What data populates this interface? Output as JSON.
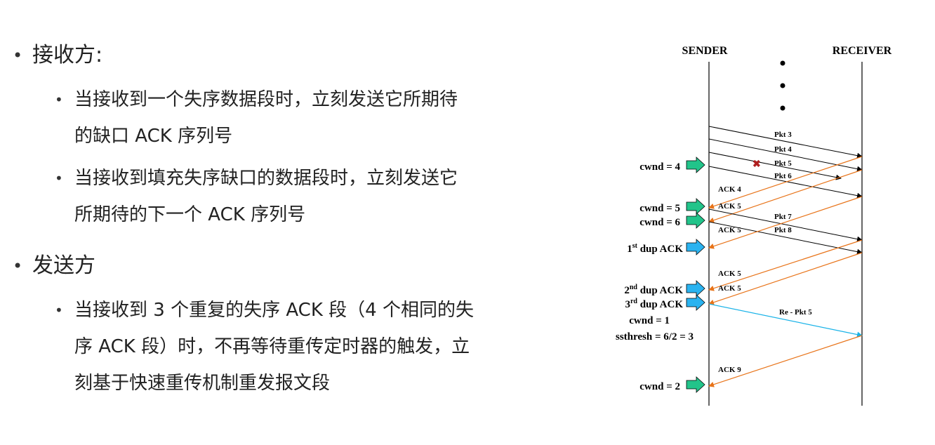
{
  "text": {
    "receiver_heading": "接收方:",
    "receiver_bullets": [
      "当接收到一个失序数据段时，立刻发送它所期待的缺口 ACK 序列号",
      "当接收到填充失序缺口的数据段时，立刻发送它所期待的下一个 ACK 序列号"
    ],
    "sender_heading": "发送方",
    "sender_bullets": [
      "当接收到 3 个重复的失序 ACK 段（4 个相同的失序 ACK 段）时，不再等待重传定时器的触发，立刻基于快速重传机制重发报文段"
    ]
  },
  "diagram": {
    "sender_label": "SENDER",
    "receiver_label": "RECEIVER",
    "left_labels": {
      "cwnd4": "cwnd = 4",
      "cwnd5": "cwnd = 5",
      "cwnd6": "cwnd = 6",
      "dup1_a": "1",
      "dup1_sup": "st",
      "dup1_b": " dup ACK",
      "dup2_a": "2",
      "dup2_sup": "nd",
      "dup2_b": " dup ACK",
      "dup3_a": "3",
      "dup3_sup": "rd",
      "dup3_b": " dup ACK",
      "cwnd1": "cwnd = 1",
      "ssthresh": "ssthresh = 6/2 = 3",
      "cwnd2": "cwnd = 2"
    },
    "msg_labels": {
      "pkt3": "Pkt 3",
      "pkt4": "Pkt 4",
      "pkt5": "Pkt 5",
      "pkt6": "Pkt 6",
      "ack4": "ACK 4",
      "ack5a": "ACK 5",
      "pkt7": "Pkt 7",
      "ack5b": "ACK 5",
      "pkt8": "Pkt 8",
      "ack5c": "ACK 5",
      "ack5d": "ACK 5",
      "repkt5": "Re -  Pkt 5",
      "ack9": "ACK 9"
    },
    "colors": {
      "black_line": "#000000",
      "ack_orange": "#e8741a",
      "retransmit_cyan": "#1ab3e8",
      "arrow_green": "#22c48a",
      "arrow_blue": "#2ab3f0",
      "loss_mark": "#b02020"
    }
  }
}
